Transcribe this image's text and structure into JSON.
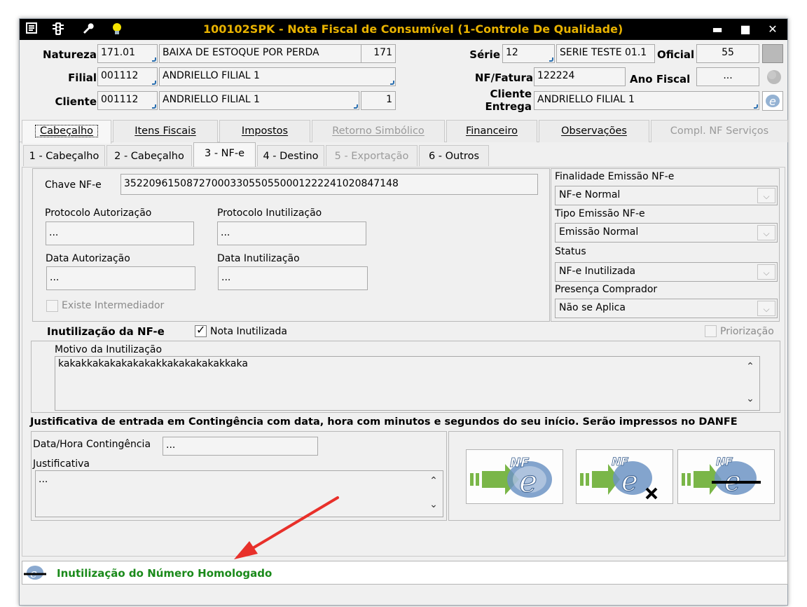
{
  "window": {
    "title": "100102SPK - Nota Fiscal de Consumível (1-Controle De Qualidade)",
    "icons": [
      "menu-icon",
      "traffic-light-icon",
      "wrench-icon",
      "lightbulb-icon"
    ],
    "controls": {
      "minimize": "▬",
      "maximize": "■",
      "close": "✕"
    }
  },
  "header": {
    "natureza": {
      "label": "Natureza",
      "code": "171.01",
      "desc": "BAIXA DE ESTOQUE POR PERDA",
      "extra": "171"
    },
    "filial": {
      "label": "Filial",
      "code": "001112",
      "desc": "ANDRIELLO FILIAL 1"
    },
    "cliente": {
      "label": "Cliente",
      "code": "001112",
      "desc": "ANDRIELLO FILIAL 1",
      "extra": "1"
    },
    "serie": {
      "label": "Série",
      "code": "12",
      "desc": "SERIE TESTE 01.1"
    },
    "oficial": {
      "label": "Oficial",
      "value": "55"
    },
    "nf_fatura": {
      "label": "NF/Fatura",
      "value": "122224"
    },
    "ano_fiscal": {
      "label": "Ano Fiscal",
      "value": "..."
    },
    "cliente_entrega": {
      "label_line1": "Cliente",
      "label_line2": "Entrega",
      "value": "ANDRIELLO FILIAL 1"
    }
  },
  "tabs": [
    {
      "label": "Cabeçalho",
      "active": true,
      "disabled": false
    },
    {
      "label": "Itens Fiscais",
      "active": false,
      "disabled": false
    },
    {
      "label": "Impostos",
      "active": false,
      "disabled": false
    },
    {
      "label": "Retorno Simbólico",
      "active": false,
      "disabled": true
    },
    {
      "label": "Financeiro",
      "active": false,
      "disabled": false
    },
    {
      "label": "Observações",
      "active": false,
      "disabled": false
    },
    {
      "label": "Compl. NF Serviços",
      "active": false,
      "disabled": true
    }
  ],
  "subtabs": [
    {
      "label": "1 - Cabeçalho",
      "active": false,
      "disabled": false
    },
    {
      "label": "2 - Cabeçalho",
      "active": false,
      "disabled": false
    },
    {
      "label": "3 - NF-e",
      "active": true,
      "disabled": false
    },
    {
      "label": "4 - Destino",
      "active": false,
      "disabled": false
    },
    {
      "label": "5 - Exportação",
      "active": false,
      "disabled": true
    },
    {
      "label": "6 - Outros",
      "active": false,
      "disabled": false
    }
  ],
  "nfe": {
    "chave_label": "Chave NF-e",
    "chave_value": "35220961508727000330550550001222241020847148",
    "protocolo_autorizacao_label": "Protocolo Autorização",
    "protocolo_autorizacao_value": "...",
    "protocolo_inutilizacao_label": "Protocolo Inutilização",
    "protocolo_inutilizacao_value": "...",
    "data_autorizacao_label": "Data Autorização",
    "data_autorizacao_value": "...",
    "data_inutilizacao_label": "Data Inutilização",
    "data_inutilizacao_value": "...",
    "existe_intermediador_label": "Existe Intermediador",
    "existe_intermediador_checked": false
  },
  "right_panel": {
    "finalidade_label": "Finalidade Emissão NF-e",
    "finalidade_value": "NF-e Normal",
    "tipo_emissao_label": "Tipo Emissão NF-e",
    "tipo_emissao_value": "Emissão Normal",
    "status_label": "Status",
    "status_value": "NF-e Inutilizada",
    "presenca_label": "Presença Comprador",
    "presenca_value": "Não se Aplica"
  },
  "inutilizacao": {
    "title": "Inutilização da NF-e",
    "nota_inutilizada_label": "Nota Inutilizada",
    "nota_inutilizada_checked": true,
    "priorizacao_label": "Priorização",
    "priorizacao_checked": false,
    "motivo_label": "Motivo da Inutilização",
    "motivo_value": "kakakkakakakakakakkakakakakakkaka"
  },
  "contingencia": {
    "title": "Justificativa de entrada em Contingência com data, hora com minutos e segundos do seu início. Serão impressos no DANFE",
    "data_hora_label": "Data/Hora Contingência",
    "data_hora_value": "...",
    "justificativa_label": "Justificativa",
    "justificativa_value": "..."
  },
  "action_buttons": [
    {
      "name": "nfe-transmit-icon"
    },
    {
      "name": "nfe-cancel-icon"
    },
    {
      "name": "nfe-inutilize-icon"
    }
  ],
  "status_bar": {
    "text": "Inutilização do Número Homologado",
    "color": "#1a8a1a"
  },
  "colors": {
    "title_bg": "#000000",
    "title_text": "#e8b200",
    "annotation_arrow": "#e8302a"
  }
}
